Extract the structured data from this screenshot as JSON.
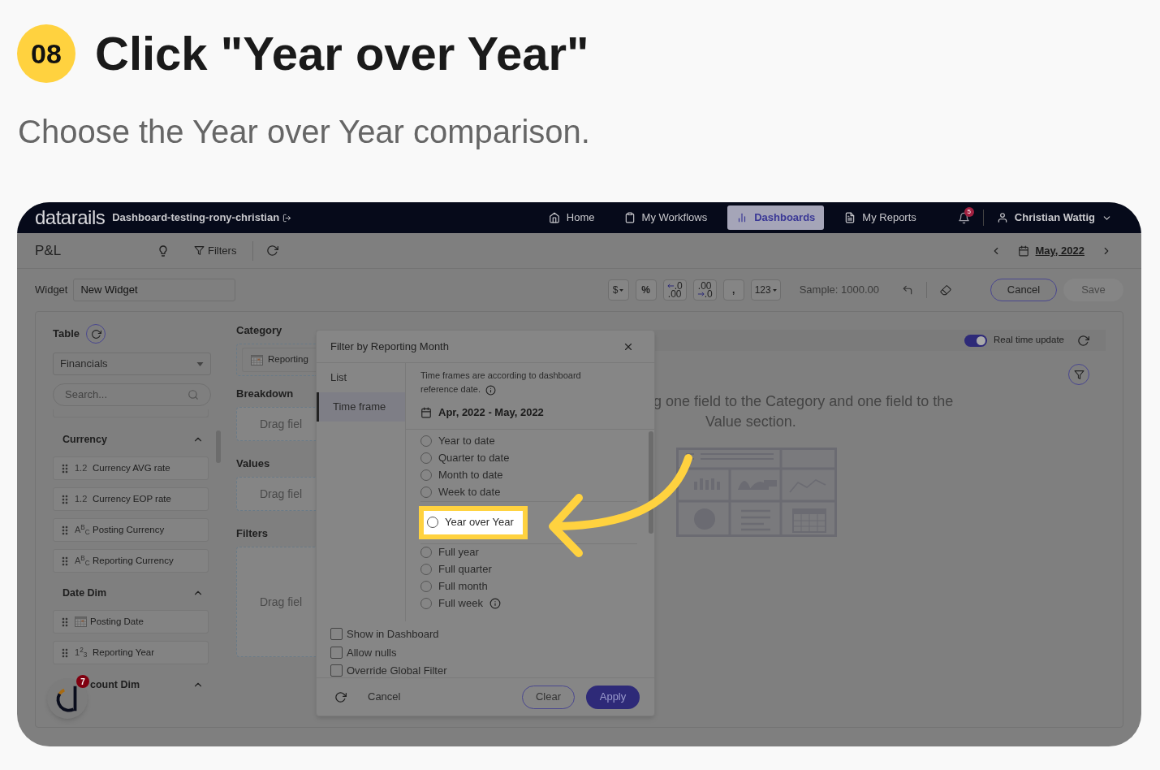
{
  "step": {
    "number": "08",
    "title": "Click \"Year over Year\"",
    "subtitle": "Choose the Year over Year comparison."
  },
  "nav": {
    "logo": "datarails",
    "workspace": "Dashboard-testing-rony-christian",
    "items": [
      {
        "label": "Home",
        "selected": false
      },
      {
        "label": "My Workflows",
        "selected": false
      },
      {
        "label": "Dashboards",
        "selected": true
      },
      {
        "label": "My Reports",
        "selected": false
      }
    ],
    "notifications": "5",
    "user": "Christian Wattig"
  },
  "toolbar": {
    "title": "P&L",
    "filters": "Filters",
    "date": "May, 2022"
  },
  "widget": {
    "label": "Widget",
    "name": "New Widget",
    "format_buttons": [
      {
        "kind": "dropdown",
        "label": "$"
      },
      {
        "kind": "plain",
        "label": "%"
      },
      {
        "kind": "decrease",
        "top": ".0",
        "bottom": ".00"
      },
      {
        "kind": "increase",
        "top": ".00",
        "bottom": ".0"
      },
      {
        "kind": "plain",
        "label": ","
      },
      {
        "kind": "dropdown",
        "label": "123"
      }
    ],
    "sample": "Sample: 1000.00",
    "cancel": "Cancel",
    "save": "Save"
  },
  "sidebar": {
    "title": "Table",
    "table": "Financials",
    "search_placeholder": "Search...",
    "groups": [
      {
        "name": "Currency",
        "expanded": true,
        "fields": [
          {
            "kind": "number",
            "type_label": "1.2",
            "label": "Currency AVG rate"
          },
          {
            "kind": "number",
            "type_label": "1.2",
            "label": "Currency EOP rate"
          },
          {
            "kind": "text",
            "type_label": "A$^{B}$$_{C}$",
            "label": "Posting Currency"
          },
          {
            "kind": "text",
            "type_label": "A$^{B}$$_{C}$",
            "label": "Reporting Currency"
          }
        ]
      },
      {
        "name": "Date Dim",
        "expanded": true,
        "fields": [
          {
            "kind": "date",
            "label": "Posting Date"
          },
          {
            "kind": "number",
            "type_label": "1$^{2}$$_{3}$",
            "label": "Reporting Year"
          }
        ]
      },
      {
        "name": "count Dim",
        "expanded": true
      }
    ],
    "assistant_badge": "7"
  },
  "builder": {
    "sections": [
      {
        "title": "Category",
        "kind": "filled",
        "chip": "Reporting"
      },
      {
        "title": "Breakdown",
        "kind": "empty",
        "placeholder": "Drag fiel"
      },
      {
        "title": "Values",
        "kind": "empty",
        "placeholder": "Drag fiel"
      },
      {
        "title": "Filters",
        "kind": "tall",
        "placeholder": "Drag fiel"
      }
    ]
  },
  "canvas": {
    "realtime_label": "Real time update",
    "realtime_on": true,
    "message_lines": [
      "g one field to the Category and one field to the",
      "Value section."
    ]
  },
  "dialog": {
    "title": "Filter by Reporting Month",
    "tabs": [
      {
        "label": "List",
        "selected": false
      },
      {
        "label": "Time frame",
        "selected": true
      }
    ],
    "note": "Time frames are according to dashboard reference date.",
    "range": "Apr, 2022 - May, 2022",
    "option_groups": [
      {
        "options": [
          {
            "label": "Year to date",
            "selected": false
          },
          {
            "label": "Quarter to date",
            "selected": false
          },
          {
            "label": "Month to date",
            "selected": false
          },
          {
            "label": "Week to date",
            "selected": false
          }
        ]
      },
      {
        "options": [
          {
            "label": "Year over Year",
            "selected": false,
            "highlighted": true
          }
        ]
      },
      {
        "options": [
          {
            "label": "Full year",
            "selected": false
          },
          {
            "label": "Full quarter",
            "selected": false
          },
          {
            "label": "Full month",
            "selected": false
          },
          {
            "label": "Full week",
            "selected": false,
            "info": true
          }
        ]
      }
    ],
    "checkboxes": [
      {
        "label": "Show in Dashboard",
        "checked": false
      },
      {
        "label": "Allow nulls",
        "checked": false
      },
      {
        "label": "Override Global Filter",
        "checked": false
      }
    ],
    "cancel": "Cancel",
    "clear": "Clear",
    "apply": "Apply"
  }
}
